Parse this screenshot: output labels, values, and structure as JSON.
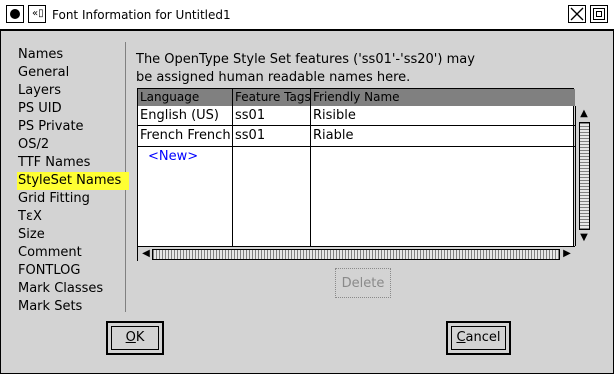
{
  "window": {
    "title": "Font Information for Untitled1"
  },
  "sidebar": {
    "items": [
      {
        "label": "Names"
      },
      {
        "label": "General"
      },
      {
        "label": "Layers"
      },
      {
        "label": "PS UID"
      },
      {
        "label": "PS Private"
      },
      {
        "label": "OS/2"
      },
      {
        "label": "TTF Names"
      },
      {
        "label": "StyleSet Names",
        "selected": true
      },
      {
        "label": "Grid Fitting"
      },
      {
        "label": "TεX"
      },
      {
        "label": "Size"
      },
      {
        "label": "Comment"
      },
      {
        "label": "FONTLOG"
      },
      {
        "label": "Mark Classes"
      },
      {
        "label": "Mark Sets"
      }
    ]
  },
  "panel": {
    "description_line1": "The OpenType Style Set features ('ss01'-'ss20') may",
    "description_line2": "be assigned human readable names here."
  },
  "table": {
    "columns": [
      "Language",
      "Feature Tags",
      "Friendly Name"
    ],
    "rows": [
      [
        "English (US)",
        "ss01",
        "Risible"
      ],
      [
        "French French",
        "ss01",
        "Riable"
      ]
    ],
    "new_label": "<New>"
  },
  "buttons": {
    "delete": "Delete",
    "ok": "OK",
    "cancel": "Cancel"
  },
  "colors": {
    "selected_bg": "#ffff33",
    "new_link": "#0000ff",
    "header_bg": "#808080"
  }
}
